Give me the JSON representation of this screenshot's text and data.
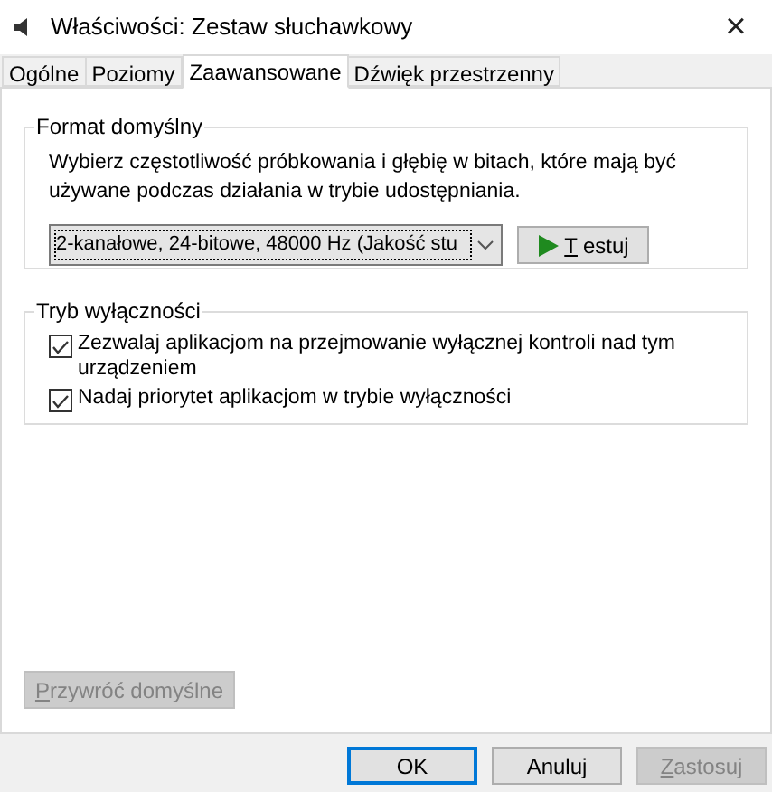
{
  "window": {
    "title": "Właściwości: Zestaw słuchawkowy",
    "close": "×"
  },
  "tabs": [
    {
      "label": "Ogólne",
      "selected": false
    },
    {
      "label": "Poziomy",
      "selected": false
    },
    {
      "label": "Zaawansowane",
      "selected": true
    },
    {
      "label": "Dźwięk przestrzenny",
      "selected": false
    }
  ],
  "format_group": {
    "title": "Format domyślny",
    "description": "Wybierz częstotliwość próbkowania i głębię w bitach, które mają być używane podczas działania w trybie udostępniania.",
    "dropdown_value": "2-kanałowe, 24-bitowe, 48000 Hz (Jakość stu",
    "test_button": {
      "label": "Testuj",
      "mnemonic": true,
      "disabled": false
    }
  },
  "exclusive_group": {
    "title": "Tryb wyłączności",
    "options": [
      {
        "label": "Zezwalaj aplikacjom na przejmowanie wyłącznej kontroli nad tym urządzeniem",
        "checked": true
      },
      {
        "label": "Nadaj priorytet aplikacjom w trybie wyłączności",
        "checked": true
      }
    ]
  },
  "restore_button": {
    "label": "Przywróć domyślne",
    "mnemonic": true,
    "disabled": true
  },
  "buttons": [
    {
      "label": "OK",
      "mnemonic": false,
      "disabled": false,
      "default": true
    },
    {
      "label": "Anuluj",
      "mnemonic": false,
      "disabled": false,
      "default": false
    },
    {
      "label": "Zastosuj",
      "mnemonic": true,
      "disabled": true,
      "default": false
    }
  ]
}
